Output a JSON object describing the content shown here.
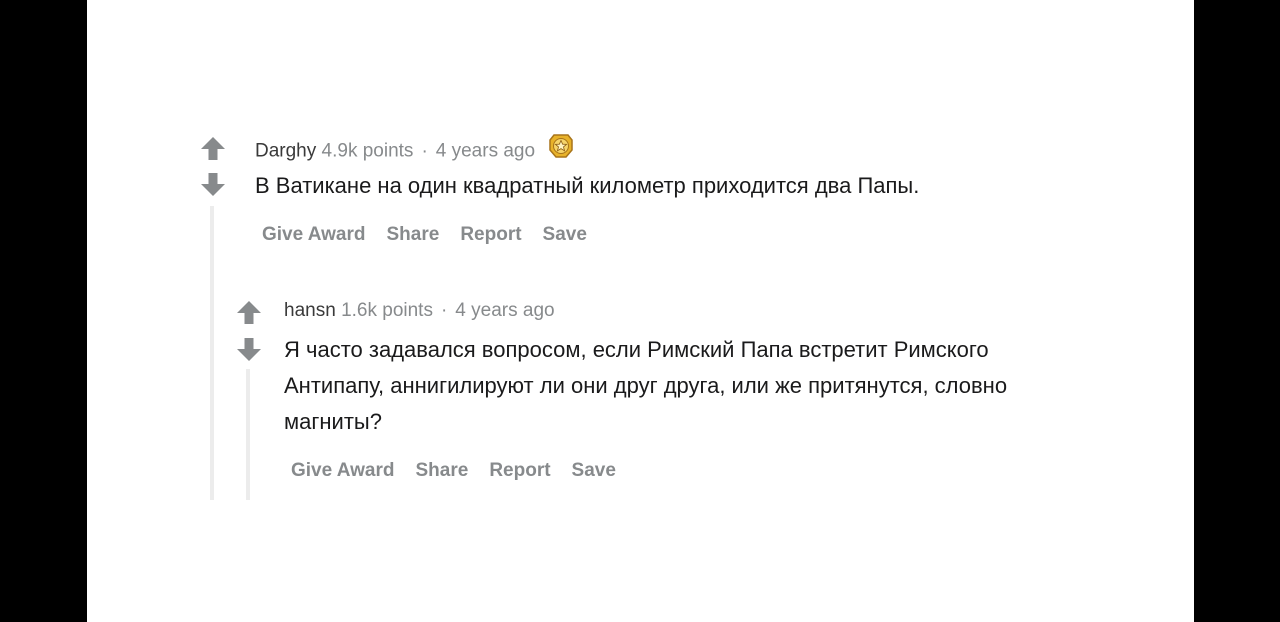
{
  "comments": [
    {
      "author": "Darghy",
      "points": "4.9k points",
      "separator": "·",
      "age": "4 years ago",
      "award_icon": "gold-award-icon",
      "text": "В Ватикане на один квадратный километр приходится два Папы.",
      "actions": [
        "Give Award",
        "Share",
        "Report",
        "Save"
      ]
    },
    {
      "author": "hansn",
      "points": "1.6k points",
      "separator": "·",
      "age": "4 years ago",
      "text": "Я часто задавался вопросом, если Римский Папа встретит Римского Антипапу, аннигилируют ли они друг друга, или же притянутся, словно магниты?",
      "actions": [
        "Give Award",
        "Share",
        "Report",
        "Save"
      ]
    }
  ],
  "colors": {
    "meta": "#878a8c",
    "author": "#3a3a3a",
    "body": "#1a1a1b",
    "vote": "#878a8c",
    "award": "#e8b22a"
  }
}
